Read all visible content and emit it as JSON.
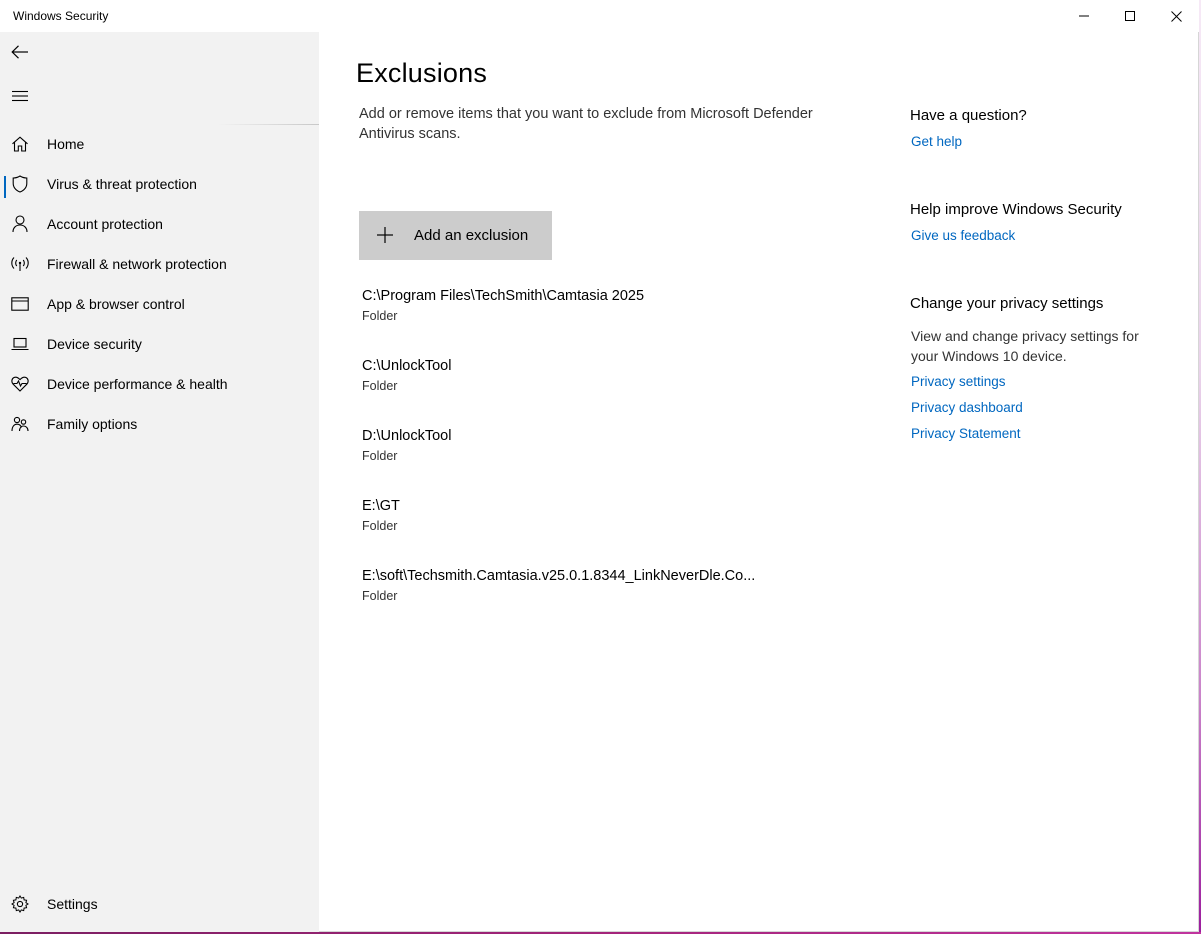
{
  "window": {
    "title": "Windows Security",
    "accent_color": "#0067c0"
  },
  "sidebar": {
    "back_icon": "back-arrow-icon",
    "menu_icon": "hamburger-menu-icon",
    "items": [
      {
        "label": "Home",
        "icon": "home-icon",
        "active": false
      },
      {
        "label": "Virus & threat protection",
        "icon": "shield-icon",
        "active": true
      },
      {
        "label": "Account protection",
        "icon": "person-icon",
        "active": false
      },
      {
        "label": "Firewall & network protection",
        "icon": "wireless-icon",
        "active": false
      },
      {
        "label": "App & browser control",
        "icon": "browser-window-icon",
        "active": false
      },
      {
        "label": "Device security",
        "icon": "laptop-icon",
        "active": false
      },
      {
        "label": "Device performance & health",
        "icon": "heart-pulse-icon",
        "active": false
      },
      {
        "label": "Family options",
        "icon": "family-icon",
        "active": false
      }
    ],
    "settings": {
      "label": "Settings",
      "icon": "gear-icon"
    }
  },
  "main": {
    "title": "Exclusions",
    "description": "Add or remove items that you want to exclude from Microsoft Defender Antivirus scans.",
    "add_button_label": "Add an exclusion",
    "exclusions": [
      {
        "path": "C:\\Program Files\\TechSmith\\Camtasia 2025",
        "type": "Folder"
      },
      {
        "path": "C:\\UnlockTool",
        "type": "Folder"
      },
      {
        "path": "D:\\UnlockTool",
        "type": "Folder"
      },
      {
        "path": "E:\\GT",
        "type": "Folder"
      },
      {
        "path": "E:\\soft\\Techsmith.Camtasia.v25.0.1.8344_LinkNeverDle.Co...",
        "type": "Folder"
      }
    ]
  },
  "aside": {
    "question_heading": "Have a question?",
    "get_help_link": "Get help",
    "improve_heading": "Help improve Windows Security",
    "feedback_link": "Give us feedback",
    "privacy_heading": "Change your privacy settings",
    "privacy_text": "View and change privacy settings for your Windows 10 device.",
    "privacy_settings_link": "Privacy settings",
    "privacy_dashboard_link": "Privacy dashboard",
    "privacy_statement_link": "Privacy Statement"
  }
}
